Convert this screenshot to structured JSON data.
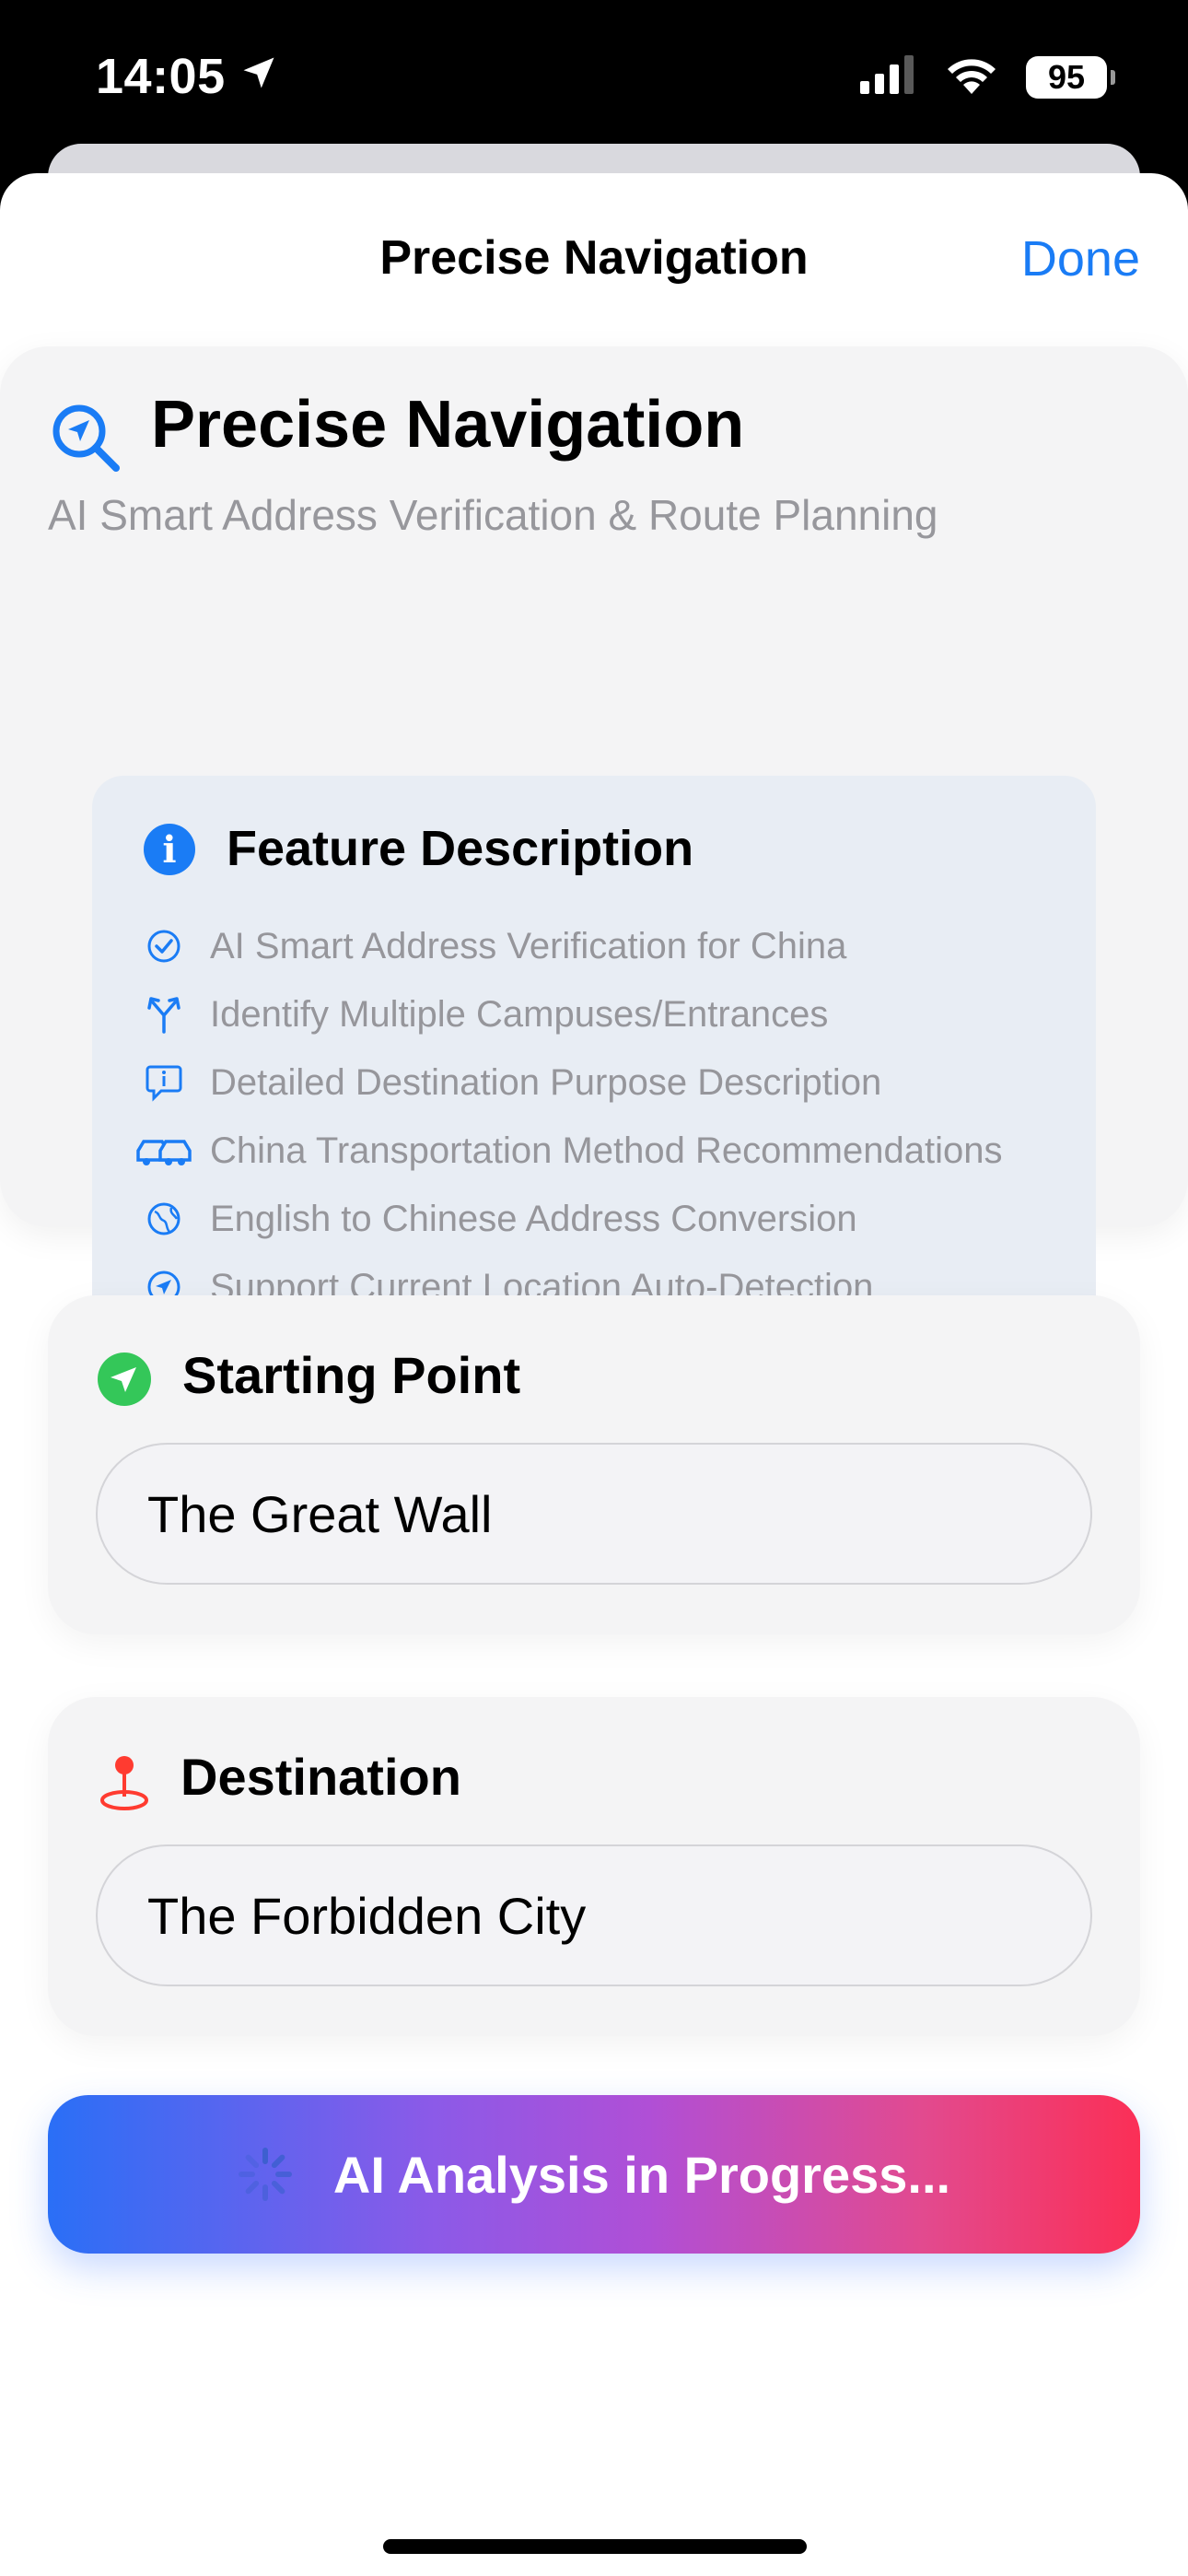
{
  "status_bar": {
    "time": "14:05",
    "battery": "95",
    "icons": [
      "location-arrow-icon",
      "cellular-signal-icon",
      "wifi-icon",
      "battery-icon"
    ]
  },
  "nav": {
    "title": "Precise Navigation",
    "done_label": "Done"
  },
  "header": {
    "icon": "magnifier-navigation-icon",
    "title": "Precise Navigation",
    "subtitle": "AI Smart Address Verification & Route Planning"
  },
  "features": {
    "title": "Feature Description",
    "items": [
      {
        "icon": "checkmark-circle-icon",
        "label": "AI Smart Address Verification for China"
      },
      {
        "icon": "branch-arrows-icon",
        "label": "Identify Multiple Campuses/Entrances"
      },
      {
        "icon": "info-bubble-icon",
        "label": "Detailed Destination Purpose Description"
      },
      {
        "icon": "cars-icon",
        "label": "China Transportation Method Recommendations"
      },
      {
        "icon": "globe-icon",
        "label": "English to Chinese Address Conversion"
      },
      {
        "icon": "location-arrow-circle-icon",
        "label": "Support Current Location Auto-Detection"
      }
    ]
  },
  "starting_point": {
    "label": "Starting Point",
    "value": "The Great Wall",
    "icon": "location-arrow-green-icon"
  },
  "destination": {
    "label": "Destination",
    "value": "The Forbidden City",
    "icon": "map-pin-icon"
  },
  "ai_button": {
    "label": "AI Analysis in Progress...",
    "icon": "spinner-icon"
  },
  "colors": {
    "accent": "#1a7cf5",
    "start_icon": "#34c759",
    "destination_icon": "#ff3b30",
    "gradient_start": "#2a6ff6",
    "gradient_end": "#fb2f56"
  }
}
